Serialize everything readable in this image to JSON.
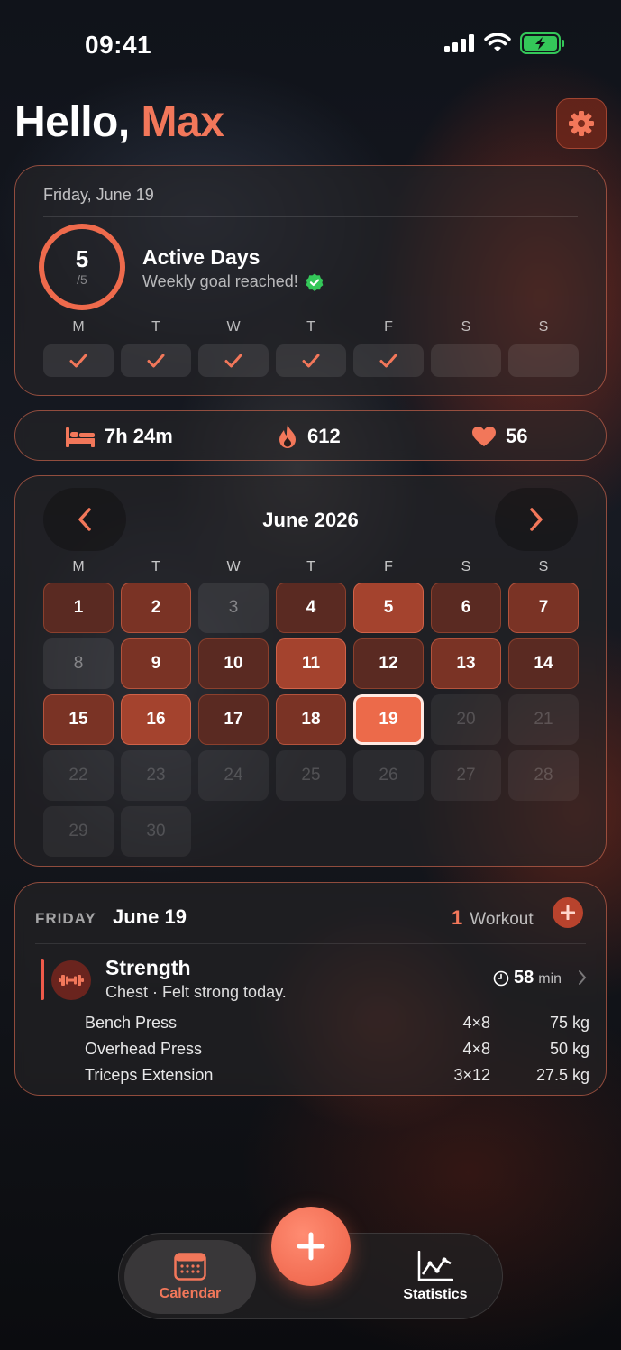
{
  "status": {
    "time": "09:41"
  },
  "header": {
    "greeting": "Hello,",
    "name": "Max"
  },
  "active_days": {
    "date": "Friday, June 19",
    "count": "5",
    "goal": "/5",
    "title": "Active Days",
    "subtitle": "Weekly goal reached!",
    "week": [
      {
        "letter": "M",
        "done": true
      },
      {
        "letter": "T",
        "done": true
      },
      {
        "letter": "W",
        "done": true
      },
      {
        "letter": "T",
        "done": true
      },
      {
        "letter": "F",
        "done": true
      },
      {
        "letter": "S",
        "done": false
      },
      {
        "letter": "S",
        "done": false
      }
    ]
  },
  "stats": {
    "sleep": "7h 24m",
    "calories": "612",
    "heart_rate": "56"
  },
  "calendar": {
    "month_title": "June 2026",
    "weekday_letters": [
      "M",
      "T",
      "W",
      "T",
      "F",
      "S",
      "S"
    ],
    "days": [
      {
        "d": "1",
        "level": 1
      },
      {
        "d": "2",
        "level": 2
      },
      {
        "d": "3",
        "level": 0
      },
      {
        "d": "4",
        "level": 1
      },
      {
        "d": "5",
        "level": 3
      },
      {
        "d": "6",
        "level": 1
      },
      {
        "d": "7",
        "level": 2
      },
      {
        "d": "8",
        "level": 0
      },
      {
        "d": "9",
        "level": 2
      },
      {
        "d": "10",
        "level": 1
      },
      {
        "d": "11",
        "level": 3
      },
      {
        "d": "12",
        "level": 1
      },
      {
        "d": "13",
        "level": 2
      },
      {
        "d": "14",
        "level": 1
      },
      {
        "d": "15",
        "level": 2
      },
      {
        "d": "16",
        "level": 3
      },
      {
        "d": "17",
        "level": 1
      },
      {
        "d": "18",
        "level": 2
      },
      {
        "d": "19",
        "level": "today"
      },
      {
        "d": "20",
        "level": "future"
      },
      {
        "d": "21",
        "level": "future"
      },
      {
        "d": "22",
        "level": "future"
      },
      {
        "d": "23",
        "level": "future"
      },
      {
        "d": "24",
        "level": "future"
      },
      {
        "d": "25",
        "level": "future"
      },
      {
        "d": "26",
        "level": "future"
      },
      {
        "d": "27",
        "level": "future"
      },
      {
        "d": "28",
        "level": "future"
      },
      {
        "d": "29",
        "level": "future"
      },
      {
        "d": "30",
        "level": "future"
      }
    ]
  },
  "workouts": {
    "day_label": "FRIDAY",
    "date": "June 19",
    "count": "1",
    "count_label": "Workout",
    "item": {
      "title": "Strength",
      "subtitle": "Chest · Felt strong today.",
      "duration": "58",
      "duration_unit": "min",
      "exercises": [
        {
          "name": "Bench Press",
          "sets": "4×8",
          "weight": "75 kg"
        },
        {
          "name": "Overhead Press",
          "sets": "4×8",
          "weight": "50 kg"
        },
        {
          "name": "Triceps Extension",
          "sets": "3×12",
          "weight": "27.5 kg"
        }
      ]
    }
  },
  "tabbar": {
    "calendar_label": "Calendar",
    "statistics_label": "Statistics"
  },
  "colors": {
    "accent": "#ec6a4a",
    "check": "#f2775a",
    "verified": "#34c759"
  },
  "icons": [
    "signal-icon",
    "wifi-icon",
    "battery-icon",
    "gear-icon",
    "check-icon",
    "verified-icon",
    "bed-icon",
    "flame-icon",
    "heart-icon",
    "chevron-left-icon",
    "chevron-right-icon",
    "dumbbell-icon",
    "clock-icon",
    "plus-icon",
    "calendar-icon",
    "chart-icon"
  ]
}
